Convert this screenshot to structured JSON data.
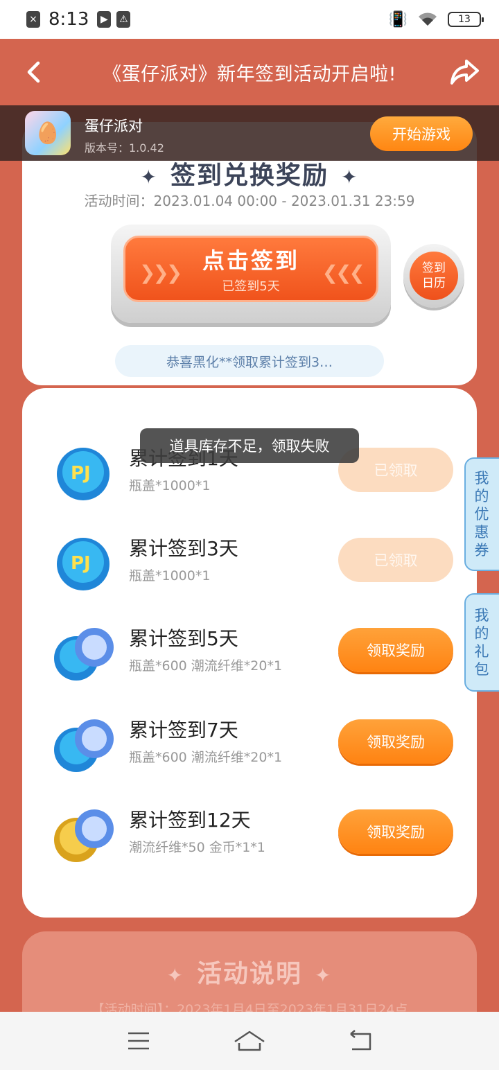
{
  "status": {
    "time": "8:13",
    "battery": "13"
  },
  "header": {
    "title": "《蛋仔派对》新年签到活动开启啦!"
  },
  "game": {
    "name": "蛋仔派对",
    "version": "版本号：1.0.42",
    "start_label": "开始游戏"
  },
  "checkin": {
    "section_title": "签到兑换奖励",
    "event_time": "活动时间：2023.01.04 00:00 - 2023.01.31 23:59",
    "button_label": "点击签到",
    "signed_text": "已签到5天",
    "calendar_label": "签到日历",
    "notice": "恭喜黑化**领取累计签到3…"
  },
  "toast": "道具库存不足，领取失败",
  "rewards": [
    {
      "title": "累计签到1天",
      "desc": "瓶盖*1000*1",
      "button": "已领取",
      "state": "claimed",
      "icon": "bottle-cap-icon"
    },
    {
      "title": "累计签到3天",
      "desc": "瓶盖*1000*1",
      "button": "已领取",
      "state": "claimed",
      "icon": "bottle-cap-icon"
    },
    {
      "title": "累计签到5天",
      "desc": "瓶盖*600 潮流纤维*20*1",
      "button": "领取奖励",
      "state": "available",
      "icon": "bottle-cap-fiber-icon"
    },
    {
      "title": "累计签到7天",
      "desc": "瓶盖*600 潮流纤维*20*1",
      "button": "领取奖励",
      "state": "available",
      "icon": "bottle-cap-fiber-icon"
    },
    {
      "title": "累计签到12天",
      "desc": "潮流纤维*50 金币*1*1",
      "button": "领取奖励",
      "state": "available",
      "icon": "coin-fiber-icon"
    }
  ],
  "side_tabs": {
    "coupons": "我的优惠券",
    "gifts": "我的礼包"
  },
  "rules": {
    "title": "活动说明",
    "text": "【活动时间】：2023年1月4日至2023年1月31日24点"
  },
  "colors": {
    "accent": "#ff8a1e",
    "background": "#d4654f",
    "link": "#3a78b5"
  }
}
